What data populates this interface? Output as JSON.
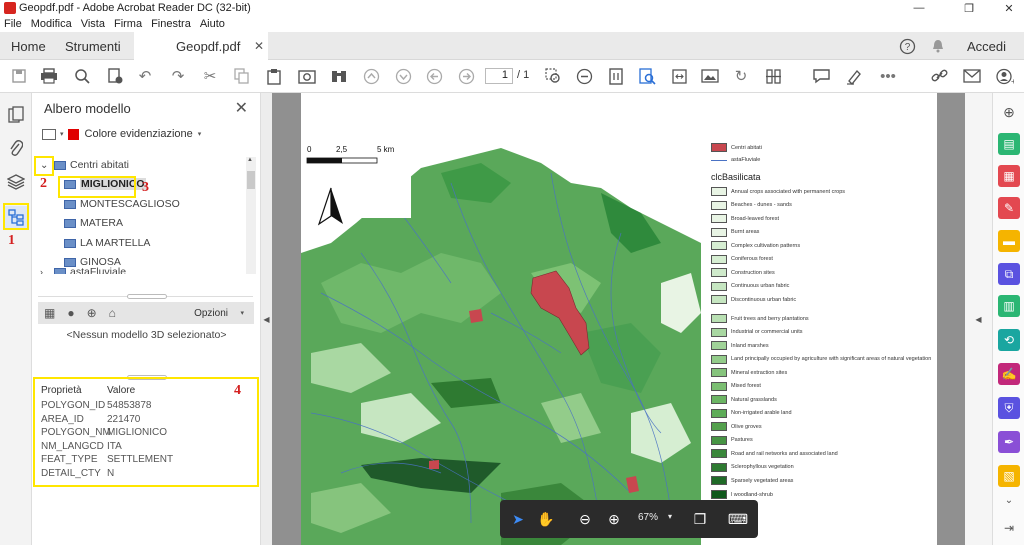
{
  "window": {
    "title": "Geopdf.pdf - Adobe Acrobat Reader DC (32-bit)"
  },
  "menu": [
    "File",
    "Modifica",
    "Vista",
    "Firma",
    "Finestra",
    "Aiuto"
  ],
  "tabs": {
    "home": "Home",
    "tools": "Strumenti",
    "document": "Geopdf.pdf",
    "signin": "Accedi"
  },
  "toolbar": {
    "page_current": "1",
    "page_total": "/ 1"
  },
  "panel": {
    "title": "Albero modello",
    "highlight_label": "Colore evidenziazione",
    "tree": {
      "group": "Centri abitati",
      "items": [
        "MIGLIONICO",
        "MONTESCAGLIOSO",
        "MATERA",
        "LA MARTELLA",
        "GINOSA"
      ],
      "cut": "astaFluviale"
    },
    "options_label": "Opzioni",
    "no_model": "<Nessun modello 3D selezionato>",
    "props_header": {
      "key": "Proprietà",
      "value": "Valore"
    },
    "props": [
      {
        "k": "POLYGON_ID",
        "v": "54853878"
      },
      {
        "k": "AREA_ID",
        "v": "221470"
      },
      {
        "k": "POLYGON_NM",
        "v": "MIGLIONICO"
      },
      {
        "k": "NM_LANGCD",
        "v": "ITA"
      },
      {
        "k": "FEAT_TYPE",
        "v": "SETTLEMENT"
      },
      {
        "k": "DETAIL_CTY",
        "v": "N"
      }
    ]
  },
  "annotations": [
    "1",
    "2",
    "3",
    "4"
  ],
  "map": {
    "scale": {
      "s0": "0",
      "s1": "2,5",
      "s2": "5 km"
    },
    "legend_top": [
      {
        "label": "Centri abitati",
        "color": "#c8474f"
      },
      {
        "label": "astaFluviale",
        "color": "#4a72c4"
      }
    ],
    "legend_title": "clcBasilicata",
    "legend": [
      {
        "label": "Annual crops associated with permanent crops",
        "color": "#e8f4e4"
      },
      {
        "label": "Beaches - dunes - sands",
        "color": "#e8f4e4"
      },
      {
        "label": "Broad-leaved forest",
        "color": "#e8f4e4"
      },
      {
        "label": "Burnt areas",
        "color": "#e8f4e4"
      },
      {
        "label": "Complex cultivation patterns",
        "color": "#d6eed2"
      },
      {
        "label": "Coniferous forest",
        "color": "#d6eed2"
      },
      {
        "label": "Construction sites",
        "color": "#cfeacb"
      },
      {
        "label": "Continuous urban fabric",
        "color": "#c6e6c1"
      },
      {
        "label": "Discontinuous urban fabric",
        "color": "#c6e6c1"
      },
      {
        "label": "Fruit trees and berry plantations",
        "color": "#b9e0b3"
      },
      {
        "label": "Industrial or commercial units",
        "color": "#a9d8a2"
      },
      {
        "label": "Inland marshes",
        "color": "#a0d398"
      },
      {
        "label": "Land principally occupied by agriculture with significant areas of natural vegetation",
        "color": "#93cc8a"
      },
      {
        "label": "Mineral extraction sites",
        "color": "#86c47d"
      },
      {
        "label": "Mixed forest",
        "color": "#7bbe72"
      },
      {
        "label": "Natural grasslands",
        "color": "#6cb564"
      },
      {
        "label": "Non-irrigated arable land",
        "color": "#5eac58"
      },
      {
        "label": "Olive groves",
        "color": "#54a04d"
      },
      {
        "label": "Pastures",
        "color": "#479444"
      },
      {
        "label": "Road and rail networks and associated land",
        "color": "#3a873b"
      },
      {
        "label": "Sclerophyllous vegetation",
        "color": "#2e7a31"
      },
      {
        "label": "Sparsely vegetated areas",
        "color": "#1f6a27"
      },
      {
        "label": "l woodland-shrub",
        "color": "#10581c"
      }
    ]
  },
  "floatbar": {
    "zoom": "67%"
  }
}
